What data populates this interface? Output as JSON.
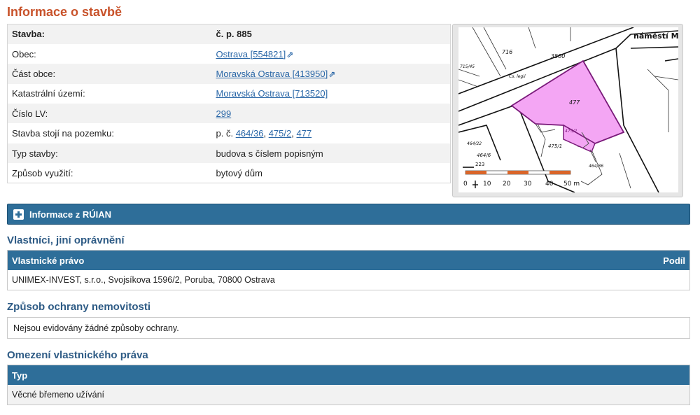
{
  "page_title": "Informace o stavbě",
  "building_info": {
    "stavba_label": "Stavba:",
    "stavba_value": "č. p. 885",
    "obec_label": "Obec:",
    "obec_link": "Ostrava [554821]",
    "cast_obce_label": "Část obce:",
    "cast_obce_link": "Moravská Ostrava [413950]",
    "ku_label": "Katastrální území:",
    "ku_link": "Moravská Ostrava [713520]",
    "lv_label": "Číslo LV:",
    "lv_link": "299",
    "pozemek_label": "Stavba stojí na pozemku:",
    "pozemek_prefix": "p. č.",
    "pozemek_links": [
      "464/36",
      "475/2",
      "477"
    ],
    "typ_label": "Typ stavby:",
    "typ_value": "budova s číslem popisným",
    "vyuziti_label": "Způsob využití:",
    "vyuziti_value": "bytový dům"
  },
  "map": {
    "street_label": "náměstí M",
    "parcel_labels": [
      "716",
      "3500",
      "Čs. legií",
      "715/45",
      "477",
      "475/1",
      "475/2",
      "464/22",
      "464/6",
      "464/36",
      "223"
    ],
    "scale_ticks": [
      "0",
      "10",
      "20",
      "30",
      "40",
      "50 m"
    ],
    "highlight_color": "#f4a6f4"
  },
  "ruian": {
    "label": "Informace z RÚIAN"
  },
  "owners": {
    "section_title": "Vlastníci, jiní oprávnění",
    "col_right": "Vlastnické právo",
    "col_share": "Podíl",
    "row": "UNIMEX-INVEST, s.r.o., Svojsíkova 1596/2, Poruba, 70800 Ostrava"
  },
  "protection": {
    "section_title": "Způsob ochrany nemovitosti",
    "text": "Nejsou evidovány žádné způsoby ochrany."
  },
  "restrictions": {
    "section_title": "Omezení vlastnického práva",
    "col_type": "Typ",
    "row": "Věcné břemeno užívání"
  }
}
